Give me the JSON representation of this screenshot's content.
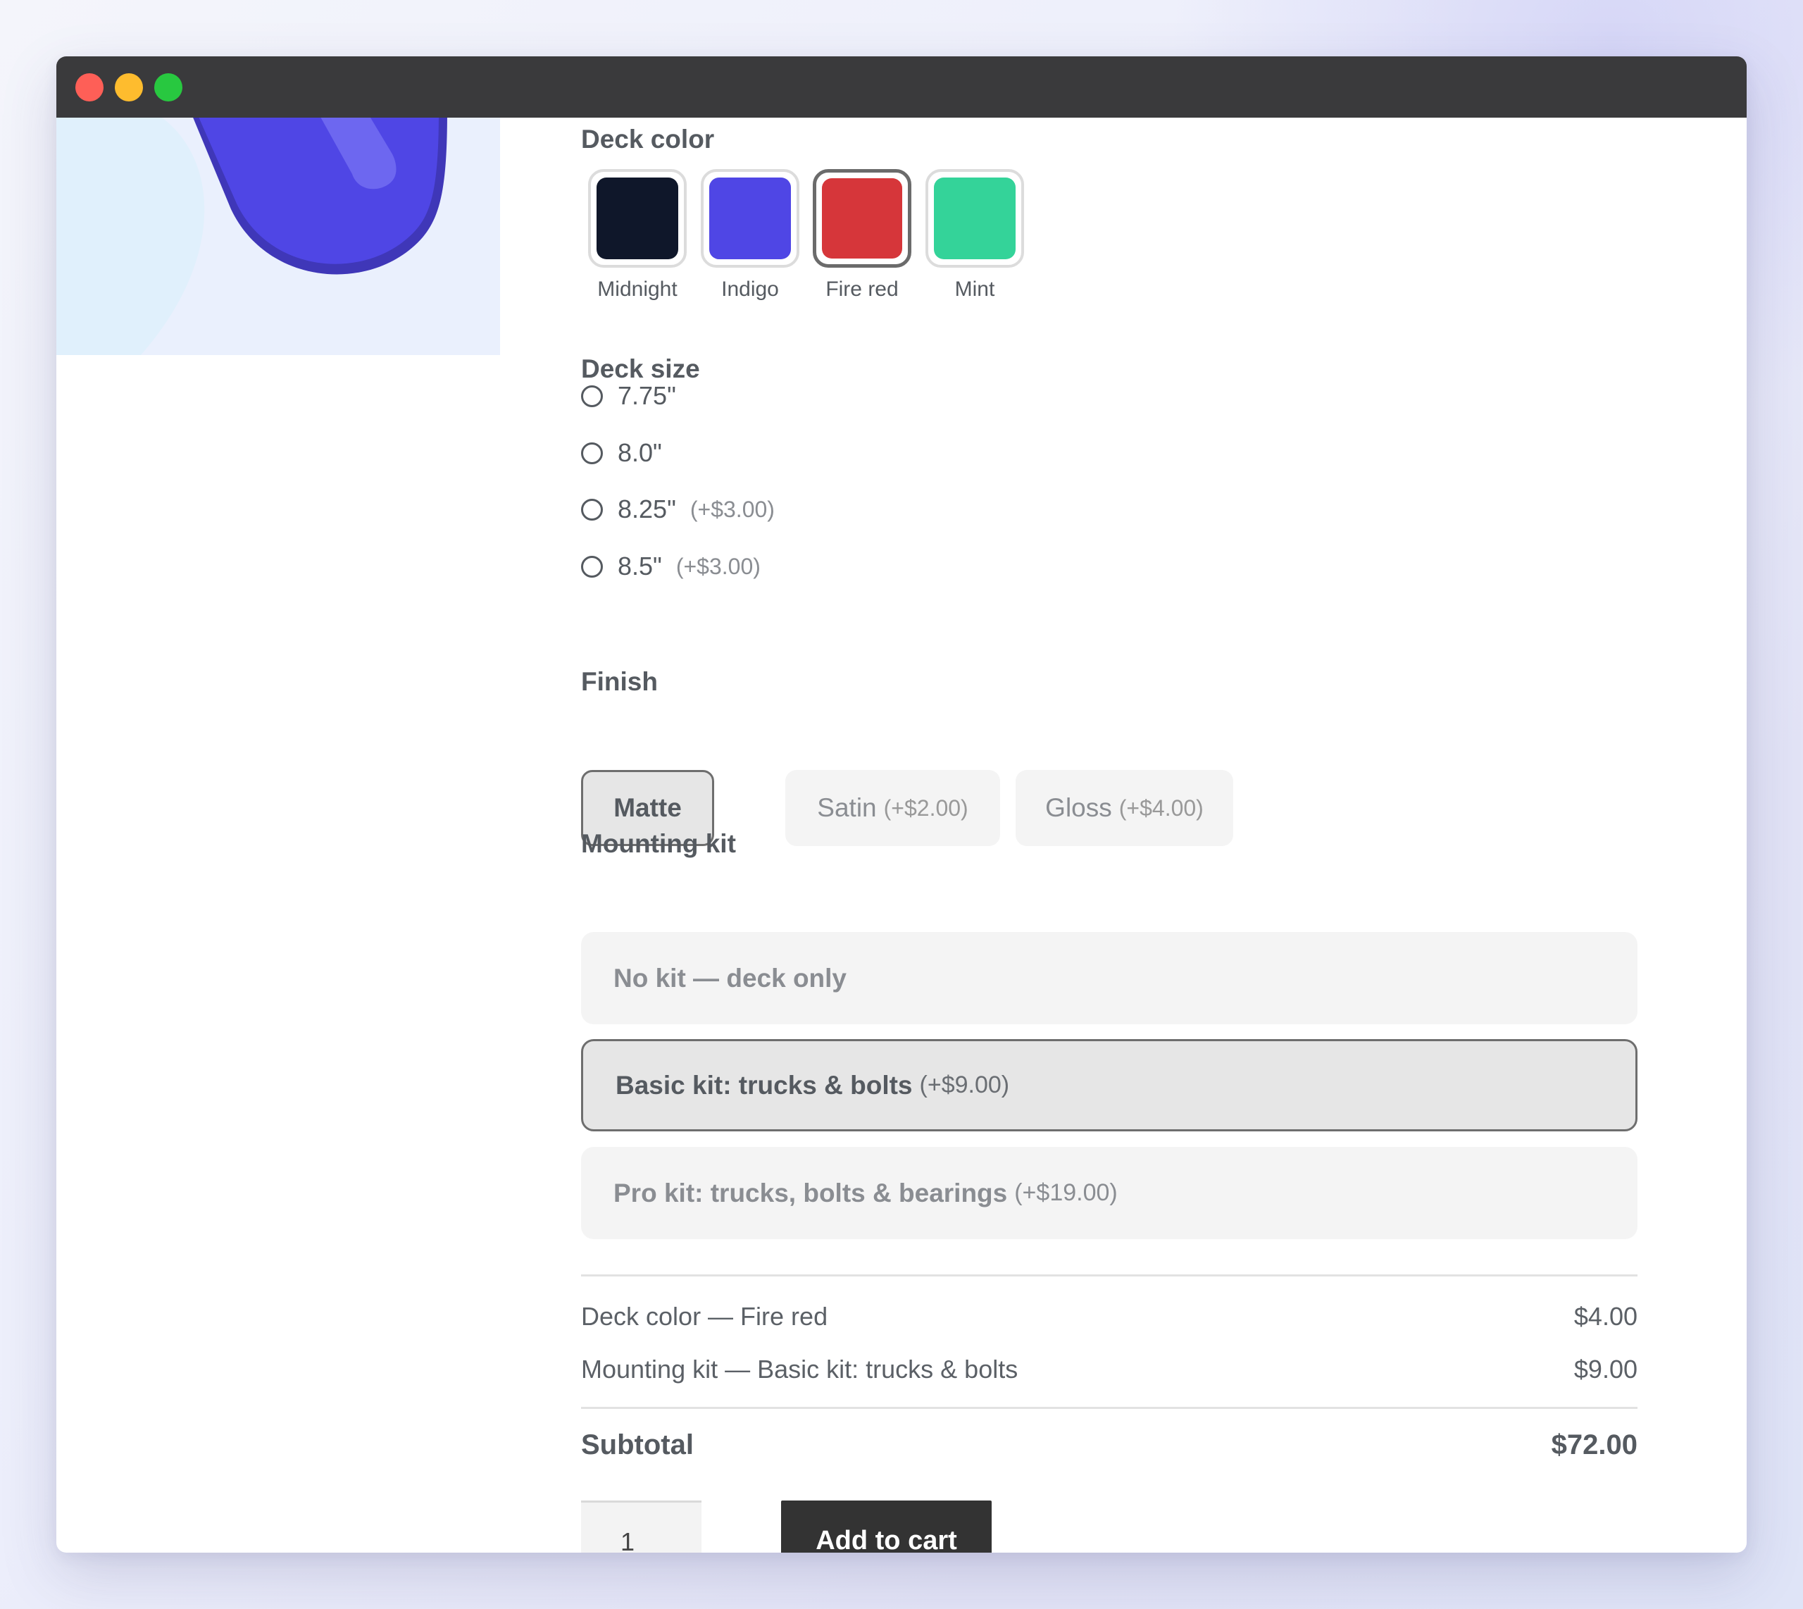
{
  "options": {
    "deck_color": {
      "label": "Deck color",
      "swatches": [
        {
          "name": "Midnight",
          "color": "#0f172a",
          "selected": false
        },
        {
          "name": "Indigo",
          "color": "#4f46e5",
          "selected": false
        },
        {
          "name": "Fire red",
          "color": "#d6363a",
          "selected": true
        },
        {
          "name": "Mint",
          "color": "#34d399",
          "selected": false
        }
      ]
    },
    "deck_size": {
      "label": "Deck size",
      "sizes": [
        {
          "label": "7.75\"",
          "price": ""
        },
        {
          "label": "8.0\"",
          "price": ""
        },
        {
          "label": "8.25\"",
          "price": "(+$3.00)"
        },
        {
          "label": "8.5\"",
          "price": "(+$3.00)"
        }
      ]
    },
    "finish": {
      "label": "Finish",
      "choices": [
        {
          "label": "Matte",
          "price": "",
          "selected": true
        },
        {
          "label": "Satin",
          "price": "(+$2.00)",
          "selected": false
        },
        {
          "label": "Gloss",
          "price": "(+$4.00)",
          "selected": false
        }
      ]
    },
    "mounting_kit": {
      "label": "Mounting kit",
      "kits": [
        {
          "label": "No kit — deck only",
          "price": "",
          "selected": false
        },
        {
          "label": "Basic kit: trucks & bolts",
          "price": "(+$9.00)",
          "selected": true
        },
        {
          "label": "Pro kit: trucks, bolts & bearings",
          "price": "(+$19.00)",
          "selected": false
        }
      ]
    }
  },
  "summary": {
    "lines": [
      {
        "label": "Deck color — Fire red",
        "value": "$4.00"
      },
      {
        "label": "Mounting kit — Basic kit: trucks & bolts",
        "value": "$9.00"
      }
    ],
    "subtotal_label": "Subtotal",
    "subtotal_value": "$72.00"
  },
  "cart": {
    "quantity": "1",
    "add_label": "Add to cart"
  },
  "colors": {
    "product_deck": "#4f46e5",
    "titlebar": "#3a3a3c",
    "button_dark": "#333333"
  }
}
